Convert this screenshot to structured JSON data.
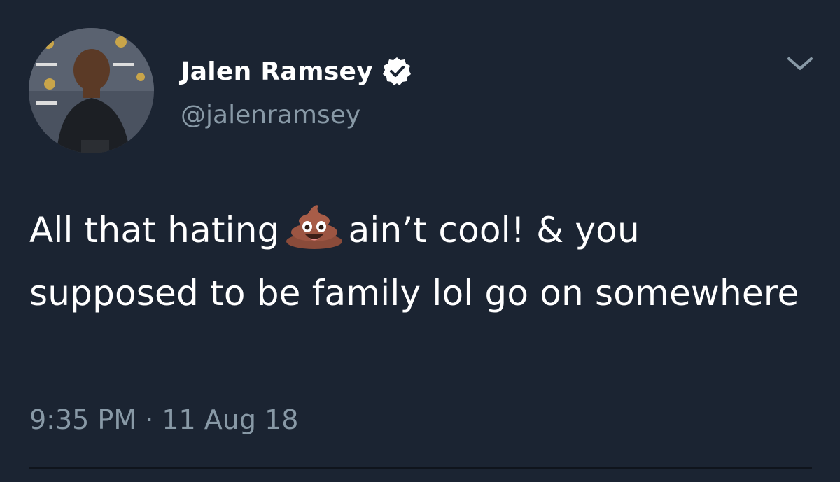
{
  "tweet": {
    "author": {
      "display_name": "Jalen Ramsey",
      "handle": "@jalenramsey",
      "verified": true,
      "verified_icon": "verified-badge-icon",
      "avatar_icon": "profile-photo"
    },
    "text_before_emoji": "All that hating",
    "emoji": "pile-of-poo-emoji",
    "text_after_emoji": "ain’t cool! & you supposed to be family lol go on somewhere",
    "timestamp": "9:35 PM · 11 Aug 18",
    "menu_icon": "chevron-down-icon"
  },
  "colors": {
    "background": "#1b2432",
    "primary_text": "#ffffff",
    "secondary_text": "#8899a6",
    "divider": "#0f141c"
  }
}
